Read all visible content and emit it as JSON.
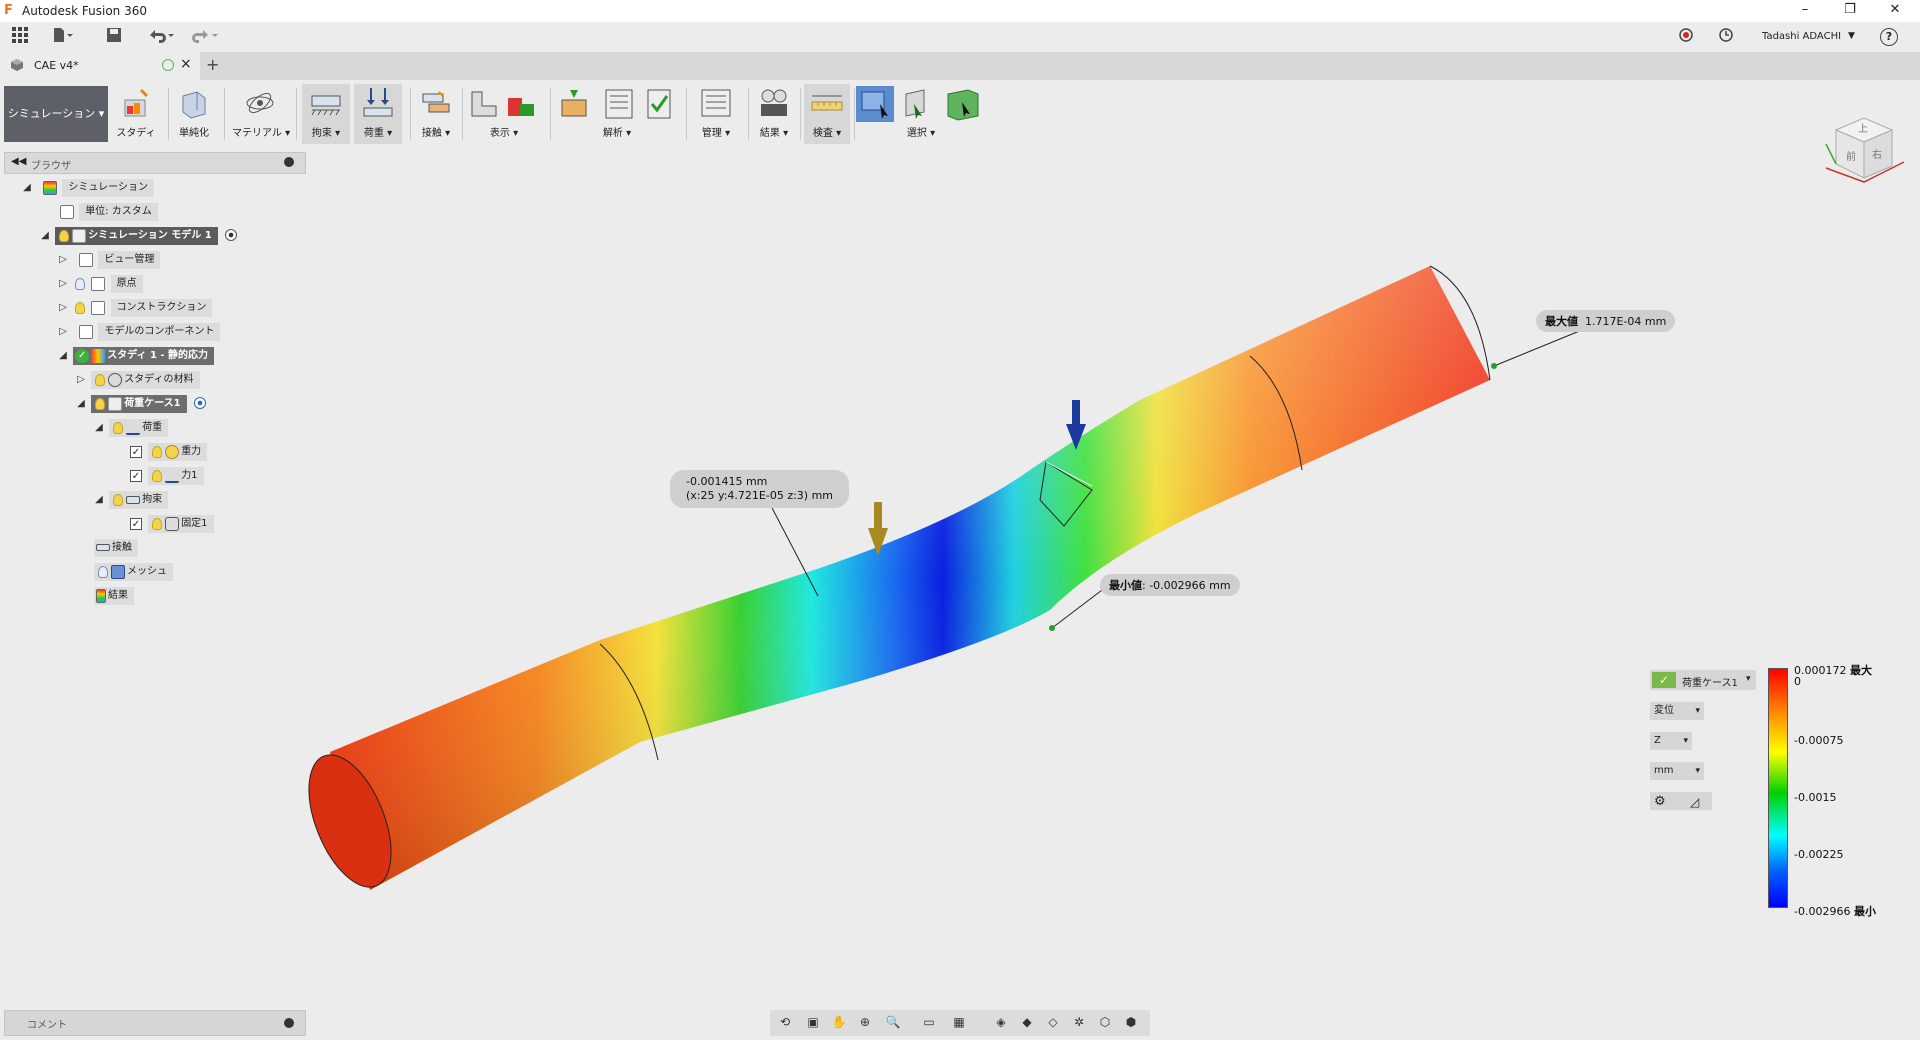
{
  "app": {
    "title": "Autodesk Fusion 360",
    "logo": "F"
  },
  "window_controls": {
    "minimize": "–",
    "restore": "❐",
    "close": "✕"
  },
  "quick_access": {
    "user": "Tadashi ADACHI",
    "help": "?"
  },
  "doc_tab": {
    "label": "CAE v4*",
    "close": "×",
    "add": "+"
  },
  "ribbon": {
    "workspace": "シミュレーション",
    "groups": [
      {
        "id": "study",
        "label": "スタディ"
      },
      {
        "id": "simplify",
        "label": "単純化"
      },
      {
        "id": "material",
        "label": "マテリアル ▾"
      },
      {
        "id": "constraint",
        "label": "拘束 ▾"
      },
      {
        "id": "load",
        "label": "荷重 ▾"
      },
      {
        "id": "contact",
        "label": "接触 ▾"
      },
      {
        "id": "display",
        "label": "表示 ▾"
      },
      {
        "id": "solve",
        "label": "解析 ▾"
      },
      {
        "id": "manage",
        "label": "管理 ▾"
      },
      {
        "id": "result",
        "label": "結果 ▾"
      },
      {
        "id": "inspect",
        "label": "検査 ▾"
      },
      {
        "id": "select",
        "label": "選択 ▾"
      }
    ]
  },
  "browser": {
    "title": "ブラウザ",
    "nodes": {
      "root": "シミュレーション",
      "units": "単位: カスタム",
      "model": "シミュレーション モデル 1",
      "views": "ビュー管理",
      "origin": "原点",
      "construction": "コンストラクション",
      "components": "モデルのコンポーネント",
      "study": "スタディ 1 - 静的応力",
      "study_material": "スタディの材料",
      "load_case": "荷重ケース1",
      "loads": "荷重",
      "gravity": "重力",
      "force": "力1",
      "constraints": "拘束",
      "fixed": "固定1",
      "contacts": "接触",
      "mesh": "メッシュ",
      "results": "結果"
    }
  },
  "viewport": {
    "viewcube_top": "上",
    "viewcube_front": "前",
    "viewcube_right": "右",
    "max_label": "最大値",
    "max_value": "1.717E-04 mm",
    "min_label": "最小値",
    "min_value": "-0.002966 mm",
    "probe_line1": "-0.001415 mm",
    "probe_line2": "(x:25 y:4.721E-05 z:3) mm"
  },
  "legend": {
    "load_case": "荷重ケース1",
    "result_type": "変位",
    "component": "Z",
    "unit": "mm",
    "max_tag": "最大",
    "min_tag": "最小",
    "ticks": [
      "0.000172",
      "0",
      "-0.00075",
      "-0.0015",
      "-0.00225",
      "-0.002966"
    ],
    "colors": {
      "red": "#ff0000",
      "yellow": "#ffff00",
      "green": "#00d000",
      "cyan": "#00ffff",
      "blue": "#0000ff"
    }
  },
  "comment": {
    "label": "コメント"
  }
}
